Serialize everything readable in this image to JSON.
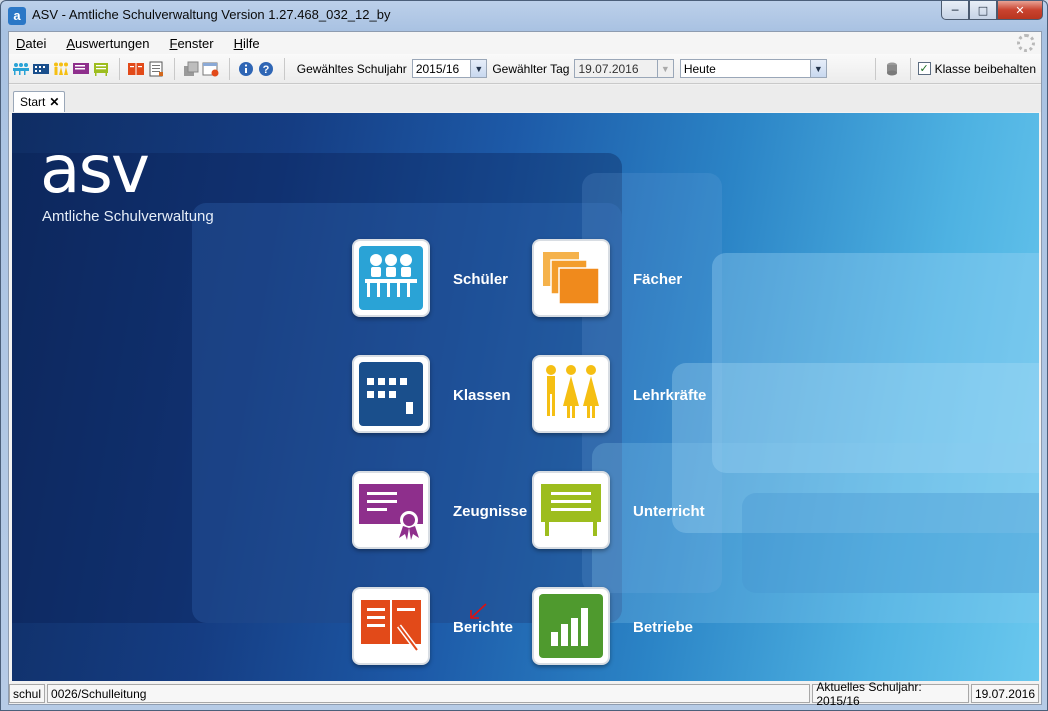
{
  "window": {
    "title": "ASV - Amtliche Schulverwaltung Version 1.27.468_032_12_by"
  },
  "menu": [
    "Datei",
    "Auswertungen",
    "Fenster",
    "Hilfe"
  ],
  "toolbar": {
    "schuljahr_label": "Gewähltes Schuljahr",
    "schuljahr_value": "2015/16",
    "tag_label": "Gewählter Tag",
    "tag_value": "19.07.2016",
    "date_mode_value": "Heute",
    "keep_class_label": "Klasse beibehalten",
    "keep_class_checked": true
  },
  "tabs": [
    {
      "label": "Start"
    }
  ],
  "branding": {
    "logo": "asv",
    "subtitle": "Amtliche Schulverwaltung"
  },
  "tiles": [
    {
      "label": "Schüler",
      "color": "#2aa3d6",
      "icon": "students-icon"
    },
    {
      "label": "Fächer",
      "color": "#f08a1c",
      "icon": "folders-icon"
    },
    {
      "label": "Klassen",
      "color": "#1a4f8c",
      "icon": "building-icon"
    },
    {
      "label": "Lehrkräfte",
      "color": "#f5bf13",
      "icon": "teachers-icon"
    },
    {
      "label": "Zeugnisse",
      "color": "#8e2f8c",
      "icon": "certificate-icon"
    },
    {
      "label": "Unterricht",
      "color": "#9dbd1e",
      "icon": "board-icon"
    },
    {
      "label": "Berichte",
      "color": "#e24a19",
      "icon": "report-book-icon"
    },
    {
      "label": "Betriebe",
      "color": "#4f9a2e",
      "icon": "bar-chart-icon"
    }
  ],
  "statusbar": {
    "user": "schul",
    "role": "0026/Schulleitung",
    "current_year": "Aktuelles Schuljahr: 2015/16",
    "date": "19.07.2016"
  }
}
